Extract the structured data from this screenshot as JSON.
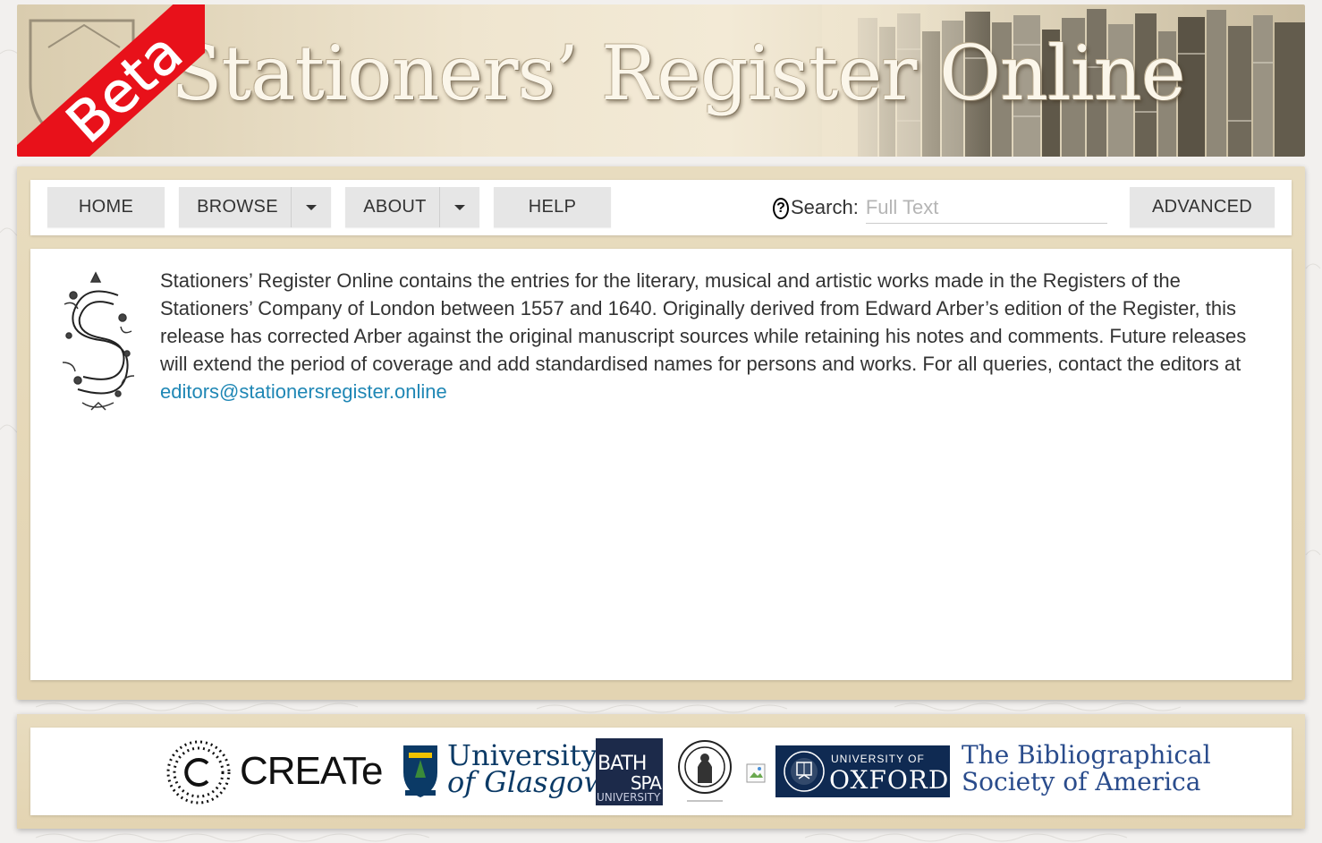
{
  "banner": {
    "title": "Stationers’ Register Online",
    "beta_label": "Beta"
  },
  "nav": {
    "home": "HOME",
    "browse": "BROWSE",
    "about": "ABOUT",
    "help": "HELP",
    "search_label": "Search:",
    "search_help_glyph": "?",
    "search_placeholder": "Full Text",
    "search_value": "",
    "advanced": "ADVANCED"
  },
  "intro": {
    "text": "Stationers’ Register Online contains the entries for the literary, musical and artistic works made in the Registers of the Stationers’ Company of London between 1557 and 1640. Originally derived from Edward Arber’s edition of the Register, this release has corrected Arber against the original manuscript sources while retaining his notes and comments. Future releases will extend the period of coverage and add standardised names for persons and works. For all queries, contact the editors at ",
    "email": "editors@stationersregister.online"
  },
  "footer": {
    "create": "CREATe",
    "glasgow_line1": "University",
    "glasgow_line2": "of Glasgow",
    "bathspa_line1": "BATH",
    "bathspa_line2": "SPA",
    "bathspa_line3": "UNIVERSITY",
    "oxford_line1": "UNIVERSITY OF",
    "oxford_line2": "OXFORD",
    "bsa_line1": "The Bibliographical",
    "bsa_line2": "Society of America"
  },
  "colors": {
    "beta_red": "#e8111a",
    "link": "#1f87b5",
    "frame": "#e8dcbf",
    "oxford_blue": "#0f2a52"
  }
}
